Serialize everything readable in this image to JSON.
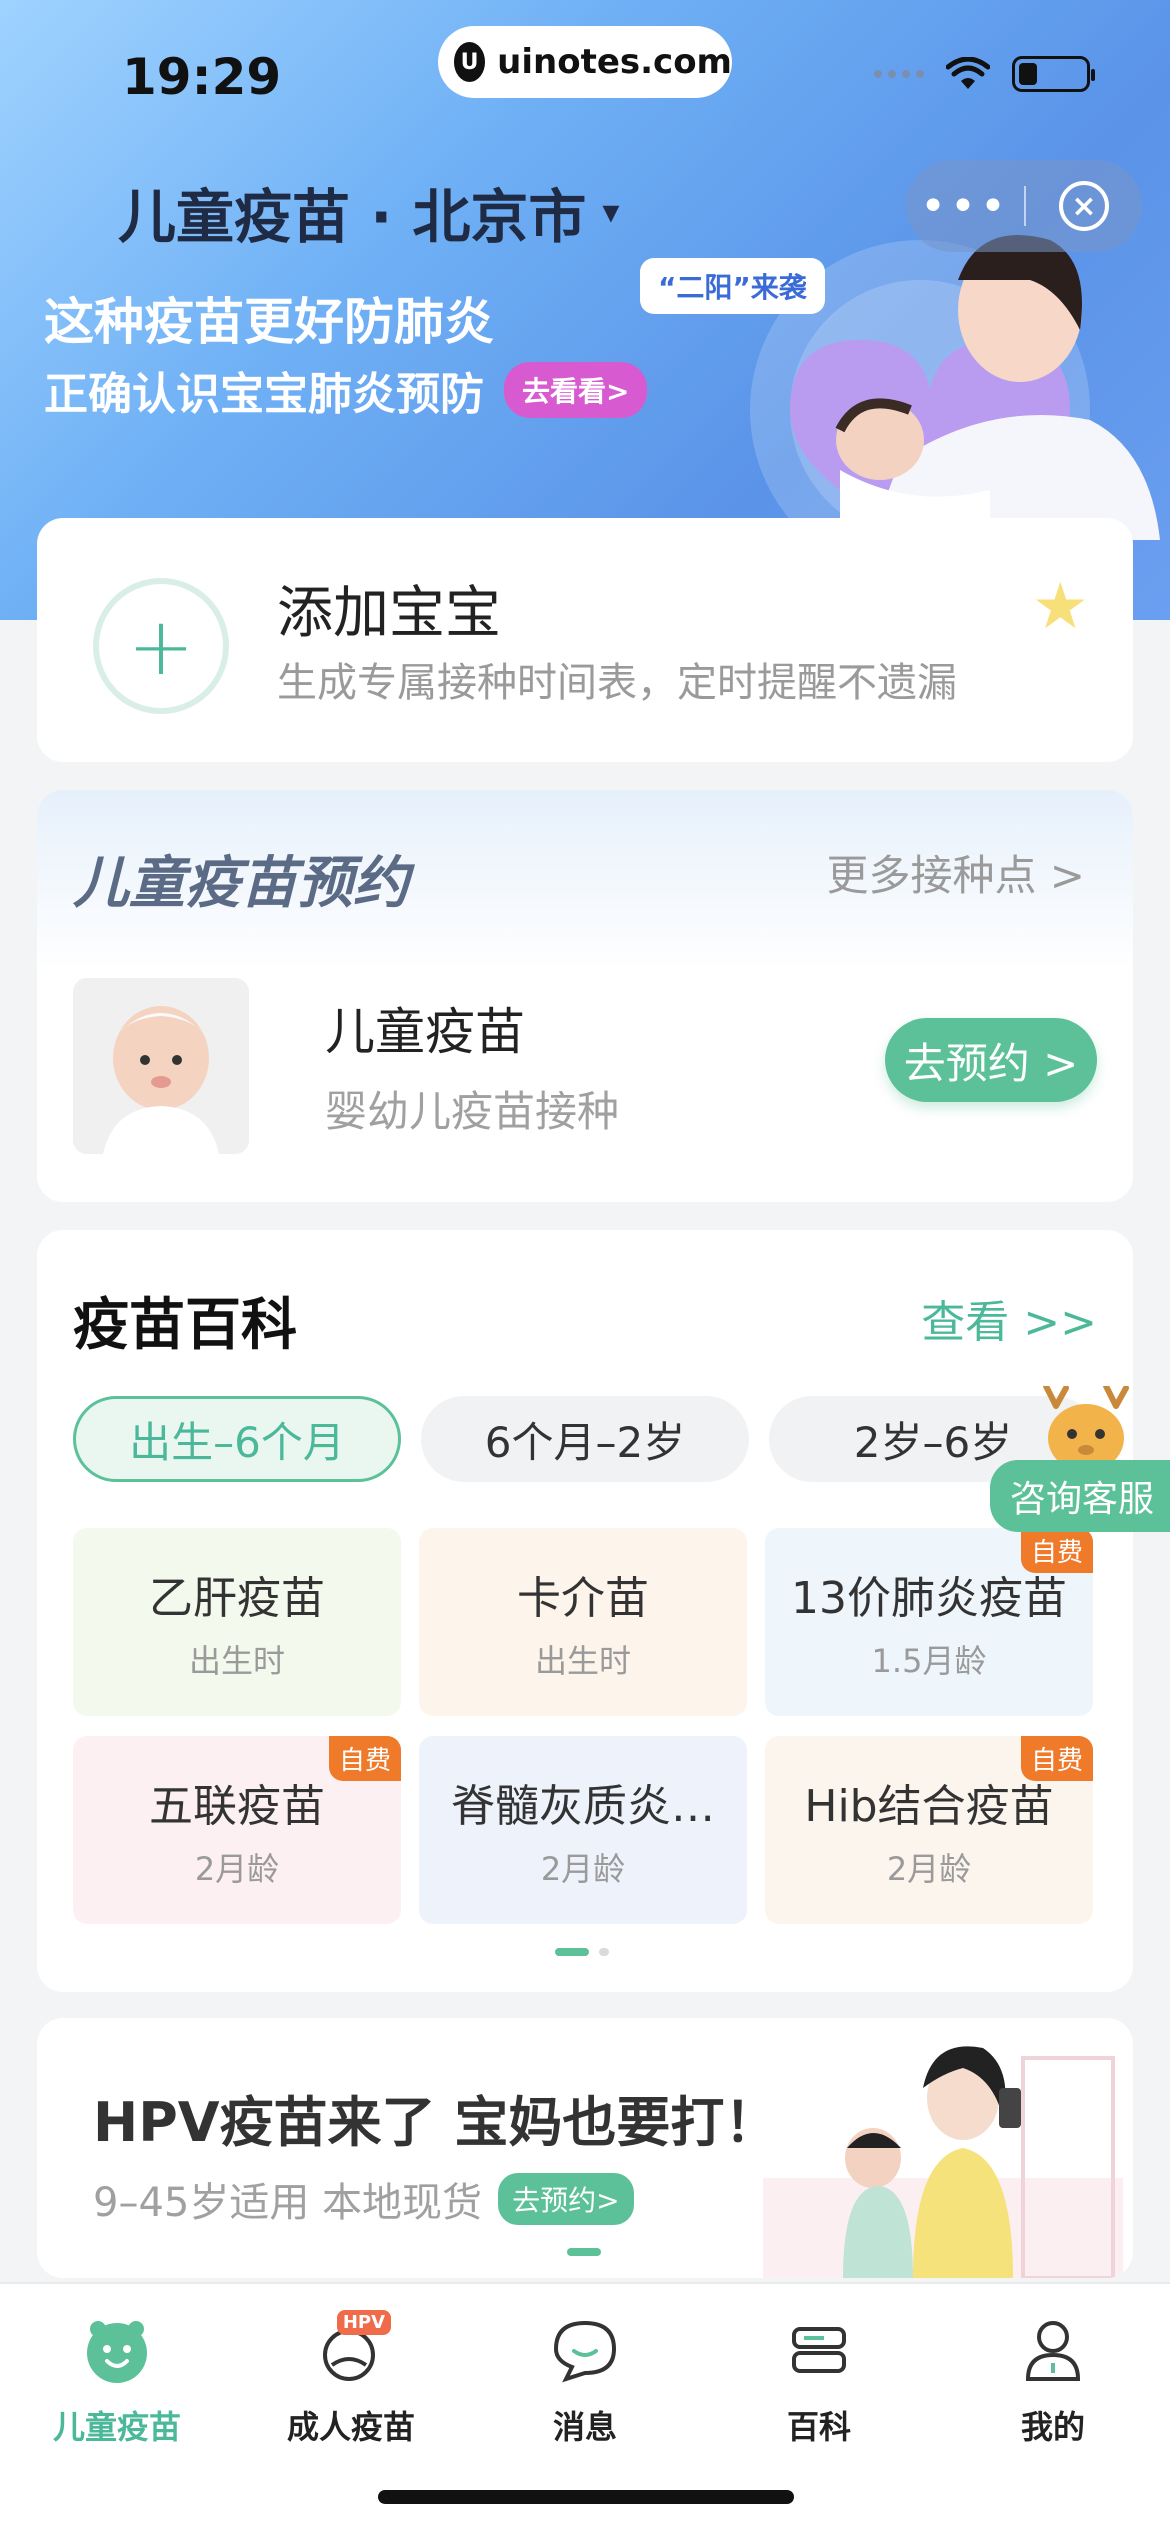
{
  "status_bar": {
    "time": "19:29",
    "url": "uinotes.com"
  },
  "header": {
    "region": "儿童疫苗 · 北京市",
    "caret": "▾"
  },
  "capsule": {
    "more": "•••",
    "close": "×"
  },
  "banner": {
    "title": "这种疫苗更好防肺炎",
    "subtitle": "正确认识宝宝肺炎预防",
    "cta": "去看看>",
    "tag": "“二阳”来袭"
  },
  "add_baby": {
    "title": "添加宝宝",
    "subtitle": "生成专属接种时间表，定时提醒不遗漏",
    "plus": "+"
  },
  "reservation": {
    "title": "儿童疫苗预约",
    "more": "更多接种点 >",
    "item": {
      "name": "儿童疫苗",
      "desc": "婴幼儿疫苗接种",
      "button": "去预约 >"
    }
  },
  "wiki": {
    "title": "疫苗百科",
    "more": "查看 >>",
    "tabs": [
      "出生–6个月",
      "6个月–2岁",
      "2岁–6岁"
    ],
    "items": [
      {
        "name": "乙肝疫苗",
        "age": "出生时",
        "badge": "",
        "color": "#f4f9ee"
      },
      {
        "name": "卡介苗",
        "age": "出生时",
        "badge": "",
        "color": "#fdf4ec"
      },
      {
        "name": "13价肺炎疫苗",
        "age": "1.5月龄",
        "badge": "自费",
        "color": "#eef6fb"
      },
      {
        "name": "五联疫苗",
        "age": "2月龄",
        "badge": "自费",
        "color": "#fdf0f2"
      },
      {
        "name": "脊髓灰质炎…",
        "age": "2月龄",
        "badge": "",
        "color": "#eef3fb"
      },
      {
        "name": "Hib结合疫苗",
        "age": "2月龄",
        "badge": "自费",
        "color": "#fcf5ee"
      }
    ]
  },
  "service": {
    "label": "咨询客服"
  },
  "hpv": {
    "title": "HPV疫苗来了 宝妈也要打！",
    "subtitle": "9–45岁适用 本地现货",
    "cta": "去预约>"
  },
  "nav": {
    "items": [
      {
        "label": "儿童疫苗",
        "icon": "child-vaccine-icon"
      },
      {
        "label": "成人疫苗",
        "icon": "adult-vaccine-icon",
        "badge": "HPV"
      },
      {
        "label": "消息",
        "icon": "message-icon"
      },
      {
        "label": "百科",
        "icon": "encyclopedia-icon"
      },
      {
        "label": "我的",
        "icon": "profile-icon"
      }
    ]
  }
}
